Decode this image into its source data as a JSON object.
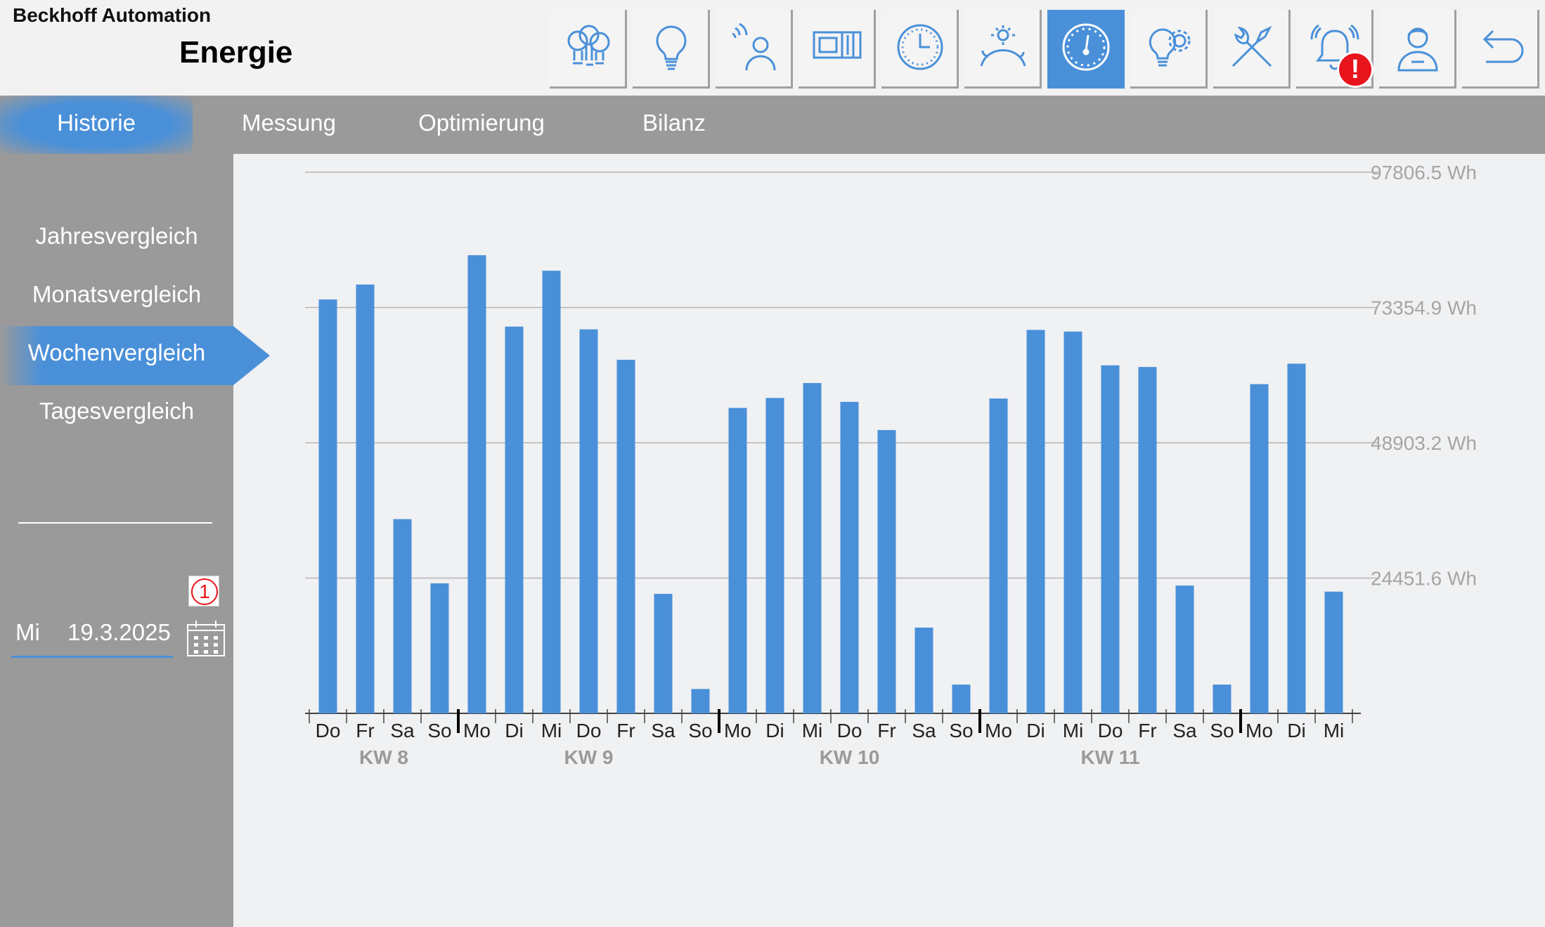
{
  "header": {
    "company": "Beckhoff Automation",
    "title": "Energie",
    "icons": [
      {
        "name": "lamps-icon",
        "active": false
      },
      {
        "name": "bulb-icon",
        "active": false
      },
      {
        "name": "presence-sensor-icon",
        "active": false
      },
      {
        "name": "blinds-icon",
        "active": false
      },
      {
        "name": "clock-icon",
        "active": false
      },
      {
        "name": "day-night-icon",
        "active": false
      },
      {
        "name": "gauge-icon",
        "active": true
      },
      {
        "name": "bulb-gear-icon",
        "active": false
      },
      {
        "name": "tools-icon",
        "active": false
      },
      {
        "name": "alarm-bell-icon",
        "active": false
      },
      {
        "name": "user-icon",
        "active": false
      },
      {
        "name": "back-arrow-icon",
        "active": false
      }
    ],
    "alert_badge": "!"
  },
  "tabs": [
    {
      "label": "Historie",
      "active": true
    },
    {
      "label": "Messung",
      "active": false
    },
    {
      "label": "Optimierung",
      "active": false
    },
    {
      "label": "Bilanz",
      "active": false
    }
  ],
  "sidebar": {
    "items": [
      {
        "label": "Jahresvergleich",
        "active": false
      },
      {
        "label": "Monatsvergleich",
        "active": false
      },
      {
        "label": "Wochenvergleich",
        "active": true
      },
      {
        "label": "Tagesvergleich",
        "active": false
      }
    ],
    "badge_number": "1",
    "date_day": "Mi",
    "date_value": "19.3.2025"
  },
  "colors": {
    "accent": "#4a90d9",
    "panel": "#9a9a9a",
    "background": "#f0f1f3",
    "alert": "#e8141c"
  },
  "chart_data": {
    "type": "bar",
    "categories": [
      "Do",
      "Fr",
      "Sa",
      "So",
      "Mo",
      "Di",
      "Mi",
      "Do",
      "Fr",
      "Sa",
      "So",
      "Mo",
      "Di",
      "Mi",
      "Do",
      "Fr",
      "Sa",
      "So",
      "Mo",
      "Di",
      "Mi",
      "Do",
      "Fr",
      "Sa",
      "So",
      "Mo",
      "Di",
      "Mi"
    ],
    "values": [
      74800,
      77500,
      35100,
      23500,
      82800,
      69900,
      80000,
      69400,
      63900,
      21600,
      4400,
      55200,
      57000,
      59700,
      56300,
      51200,
      15500,
      5200,
      56900,
      69300,
      69000,
      62900,
      62600,
      23100,
      5200,
      59500,
      63200,
      22000
    ],
    "weeks": [
      {
        "label": "KW 8",
        "start": 0,
        "end": 3
      },
      {
        "label": "KW 9",
        "start": 4,
        "end": 10
      },
      {
        "label": "KW 10",
        "start": 11,
        "end": 17
      },
      {
        "label": "KW 11",
        "start": 18,
        "end": 24
      },
      {
        "label": "",
        "start": 25,
        "end": 27
      }
    ],
    "yticks": [
      {
        "value": 24451.6,
        "label": "24451.6 Wh"
      },
      {
        "value": 48903.2,
        "label": "48903.2 Wh"
      },
      {
        "value": 73354.9,
        "label": "73354.9 Wh"
      },
      {
        "value": 97806.5,
        "label": "97806.5 Wh"
      }
    ],
    "ylim": [
      0,
      97806.5
    ],
    "grid": true,
    "bar_color": "#4a90d9"
  }
}
